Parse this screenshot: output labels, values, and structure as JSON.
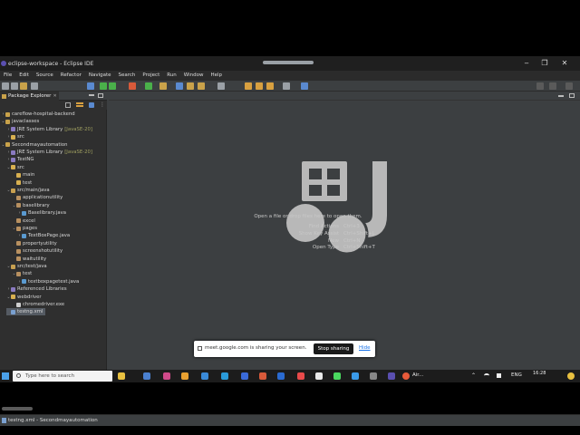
{
  "window": {
    "title": "eclipse-workspace - Eclipse IDE",
    "minimize": "‒",
    "restore": "❐",
    "close": "✕"
  },
  "menu": [
    "File",
    "Edit",
    "Source",
    "Refactor",
    "Navigate",
    "Search",
    "Project",
    "Run",
    "Window",
    "Help"
  ],
  "explorer": {
    "tab_label": "Package Explorer",
    "tab_close": "✕",
    "tree": [
      {
        "depth": 0,
        "twisty": "›",
        "icon": "project",
        "label": "careflow-hospital-backend",
        "deco": ""
      },
      {
        "depth": 0,
        "twisty": "⌄",
        "icon": "project",
        "label": "javaclasses",
        "deco": ""
      },
      {
        "depth": 1,
        "twisty": "›",
        "icon": "library",
        "label": "JRE System Library",
        "deco": "[JavaSE-20]"
      },
      {
        "depth": 1,
        "twisty": "›",
        "icon": "folder",
        "label": "src",
        "deco": ""
      },
      {
        "depth": 0,
        "twisty": "⌄",
        "icon": "project",
        "label": "Secondmayautomation",
        "deco": ""
      },
      {
        "depth": 1,
        "twisty": "›",
        "icon": "library",
        "label": "JRE System Library",
        "deco": "[JavaSE-20]"
      },
      {
        "depth": 1,
        "twisty": "›",
        "icon": "library",
        "label": "TestNG",
        "deco": ""
      },
      {
        "depth": 1,
        "twisty": "⌄",
        "icon": "folder",
        "label": "src",
        "deco": ""
      },
      {
        "depth": 2,
        "twisty": "",
        "icon": "folder",
        "label": "main",
        "deco": ""
      },
      {
        "depth": 2,
        "twisty": "",
        "icon": "folder",
        "label": "test",
        "deco": ""
      },
      {
        "depth": 1,
        "twisty": "⌄",
        "icon": "srcfolder",
        "label": "src/main/java",
        "deco": ""
      },
      {
        "depth": 2,
        "twisty": "",
        "icon": "package",
        "label": "applicationutility",
        "deco": ""
      },
      {
        "depth": 2,
        "twisty": "⌄",
        "icon": "package",
        "label": "baselibrary",
        "deco": ""
      },
      {
        "depth": 3,
        "twisty": "›",
        "icon": "java",
        "label": "Baselibrary.java",
        "deco": ""
      },
      {
        "depth": 2,
        "twisty": "",
        "icon": "package",
        "label": "excel",
        "deco": ""
      },
      {
        "depth": 2,
        "twisty": "⌄",
        "icon": "package",
        "label": "pages",
        "deco": ""
      },
      {
        "depth": 3,
        "twisty": "›",
        "icon": "java",
        "label": "TextBoxPage.java",
        "deco": ""
      },
      {
        "depth": 2,
        "twisty": "",
        "icon": "package",
        "label": "propertyutility",
        "deco": ""
      },
      {
        "depth": 2,
        "twisty": "",
        "icon": "package",
        "label": "screenshotutility",
        "deco": ""
      },
      {
        "depth": 2,
        "twisty": "",
        "icon": "package",
        "label": "waitutility",
        "deco": ""
      },
      {
        "depth": 1,
        "twisty": "⌄",
        "icon": "srcfolder",
        "label": "src/test/java",
        "deco": ""
      },
      {
        "depth": 2,
        "twisty": "⌄",
        "icon": "package",
        "label": "test",
        "deco": ""
      },
      {
        "depth": 3,
        "twisty": "›",
        "icon": "java",
        "label": "textboxpagetest.java",
        "deco": ""
      },
      {
        "depth": 1,
        "twisty": "›",
        "icon": "library",
        "label": "Referenced Libraries",
        "deco": ""
      },
      {
        "depth": 1,
        "twisty": "⌄",
        "icon": "folder",
        "label": "webdriver",
        "deco": ""
      },
      {
        "depth": 2,
        "twisty": "",
        "icon": "file",
        "label": "chromedriver.exe",
        "deco": ""
      },
      {
        "depth": 1,
        "twisty": "",
        "icon": "xml",
        "label": "testng.xml",
        "deco": ""
      }
    ]
  },
  "editor": {
    "open_hint": "Open a file or drop files here to open them.",
    "shortcuts": [
      {
        "label": "Find Actions",
        "key": "Ctrl+3"
      },
      {
        "label": "Show Key Assist",
        "key": "Ctrl+Shift+L"
      },
      {
        "label": "New",
        "key": "Ctrl+N"
      },
      {
        "label": "Open Type",
        "key": "Ctrl+Shift+T"
      }
    ]
  },
  "share_bar": {
    "message": "meet.google.com is sharing your screen.",
    "stop_label": "Stop sharing",
    "hide_label": "Hide"
  },
  "status": {
    "text": "testng.xml - Secondmayautomation"
  },
  "taskbar": {
    "search_placeholder": "Type here to search",
    "weather": "Air...",
    "language": "ENG",
    "time": "16:28"
  },
  "colors": {
    "ide_bg": "#3c3f41",
    "explorer_bg": "#2f2f2f",
    "selection": "#555b63",
    "jre_decoration": "#a0a060",
    "logo_gray": "#b8b8b8"
  }
}
